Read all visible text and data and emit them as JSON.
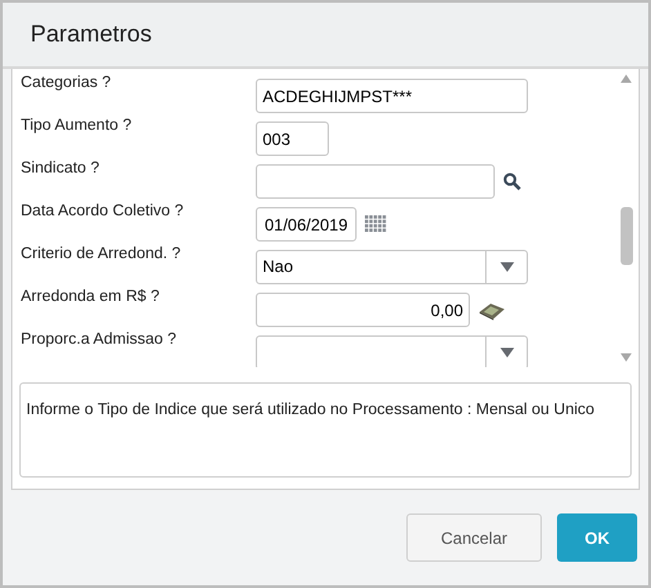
{
  "window": {
    "title": "Parametros"
  },
  "fields": [
    {
      "label": "Categorias ?",
      "kind": "text",
      "value": "ACDEGHIJMPST***"
    },
    {
      "label": "Tipo Aumento ?",
      "kind": "text",
      "value": "003"
    },
    {
      "label": "Sindicato ?",
      "kind": "lookup"
    },
    {
      "label": "Data Acordo Coletivo ?",
      "kind": "date",
      "value": "01/06/2019"
    },
    {
      "label": "Criterio de Arredond. ?",
      "kind": "select",
      "value": "Nao"
    },
    {
      "label": "Arredonda em R$ ?",
      "kind": "currency",
      "value": "0,00"
    },
    {
      "label": "Proporc.a Admissao ?",
      "kind": "select"
    }
  ],
  "help_text": "Informe o Tipo de Indice que será utilizado no Processamento : Mensal ou Unico",
  "buttons": [
    {
      "label": "Cancelar",
      "kind": "secondary"
    },
    {
      "label": "OK",
      "kind": "primary"
    }
  ]
}
